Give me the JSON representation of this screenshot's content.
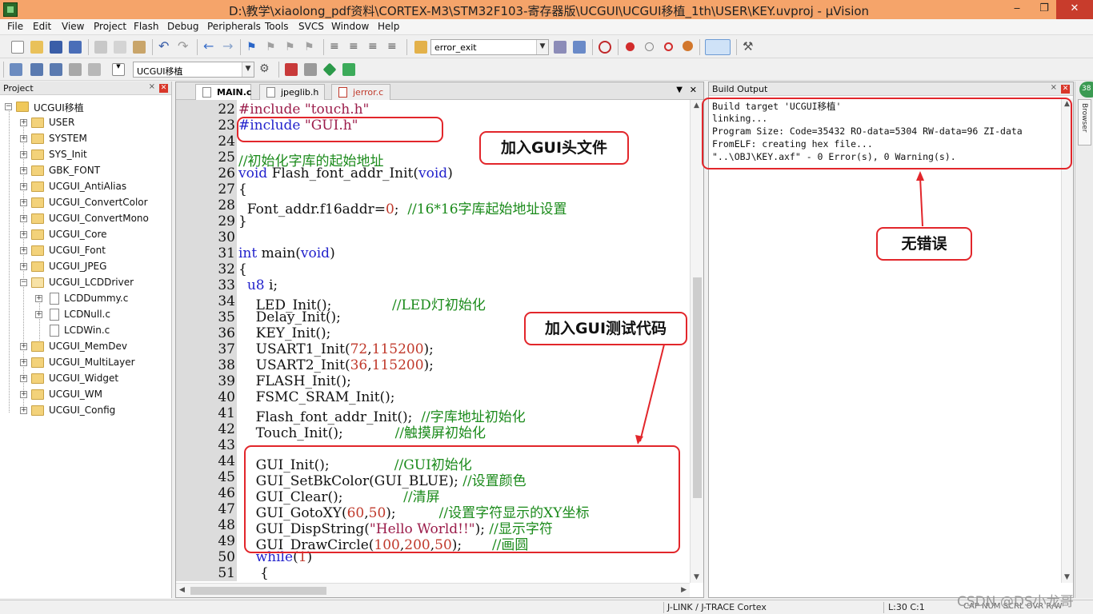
{
  "window": {
    "title": "D:\\教学\\xiaolong_pdf资料\\CORTEX-M3\\STM32F103-寄存器版\\UCGUI\\UCGUI移植_1th\\USER\\KEY.uvproj - µVision",
    "controls": [
      "minimize",
      "maximize",
      "close"
    ]
  },
  "menu": [
    "File",
    "Edit",
    "View",
    "Project",
    "Flash",
    "Debug",
    "Peripherals",
    "Tools",
    "SVCS",
    "Window",
    "Help"
  ],
  "toolbar": {
    "find_combo": "error_exit",
    "target_combo": "UCGUI移植"
  },
  "project_panel": {
    "title": "Project",
    "root": "UCGUI移植",
    "groups": [
      "USER",
      "SYSTEM",
      "SYS_Init",
      "GBK_FONT",
      "UCGUI_AntiAlias",
      "UCGUI_ConvertColor",
      "UCGUI_ConvertMono",
      "UCGUI_Core",
      "UCGUI_Font",
      "UCGUI_JPEG",
      "UCGUI_LCDDriver"
    ],
    "lcd_driver_files": [
      "LCDDummy.c",
      "LCDNull.c",
      "LCDWin.c"
    ],
    "groups_after": [
      "UCGUI_MemDev",
      "UCGUI_MultiLayer",
      "UCGUI_Widget",
      "UCGUI_WM",
      "UCGUI_Config"
    ]
  },
  "editor": {
    "tabs": [
      "MAIN.c",
      "jpeglib.h",
      "jerror.c"
    ],
    "active_tab": "MAIN.c",
    "lines": [
      {
        "n": "22",
        "parts": [
          {
            "t": "#include \"touch.h\"",
            "c": "str"
          }
        ]
      },
      {
        "n": "23",
        "parts": [
          {
            "t": "#include ",
            "c": "kw"
          },
          {
            "t": "\"GUI.h\"",
            "c": "str"
          }
        ]
      },
      {
        "n": "24",
        "parts": []
      },
      {
        "n": "25",
        "parts": [
          {
            "t": "//初始化字库的起始地址",
            "c": "cm"
          }
        ]
      },
      {
        "n": "26",
        "parts": [
          {
            "t": "void",
            "c": "kw"
          },
          {
            "t": " Flash_font_addr_Init(",
            "c": ""
          },
          {
            "t": "void",
            "c": "kw"
          },
          {
            "t": ")",
            "c": ""
          }
        ]
      },
      {
        "n": "27",
        "parts": [
          {
            "t": "{",
            "c": ""
          }
        ]
      },
      {
        "n": "28",
        "parts": [
          {
            "t": "  Font_addr.f16addr=",
            "c": ""
          },
          {
            "t": "0",
            "c": "num"
          },
          {
            "t": ";  ",
            "c": ""
          },
          {
            "t": "//16*16字库起始地址设置",
            "c": "cm"
          }
        ]
      },
      {
        "n": "29",
        "parts": [
          {
            "t": "}",
            "c": ""
          }
        ]
      },
      {
        "n": "30",
        "parts": []
      },
      {
        "n": "31",
        "parts": [
          {
            "t": "int",
            "c": "kw"
          },
          {
            "t": " main(",
            "c": ""
          },
          {
            "t": "void",
            "c": "kw"
          },
          {
            "t": ")",
            "c": ""
          }
        ]
      },
      {
        "n": "32",
        "parts": [
          {
            "t": "{",
            "c": ""
          }
        ]
      },
      {
        "n": "33",
        "parts": [
          {
            "t": "  ",
            "c": ""
          },
          {
            "t": "u8",
            "c": "kw"
          },
          {
            "t": " i;",
            "c": ""
          }
        ]
      },
      {
        "n": "34",
        "parts": [
          {
            "t": "    LED_Init();              ",
            "c": ""
          },
          {
            "t": "//LED灯初始化",
            "c": "cm"
          }
        ]
      },
      {
        "n": "35",
        "parts": [
          {
            "t": "    Delay_Init();",
            "c": ""
          }
        ]
      },
      {
        "n": "36",
        "parts": [
          {
            "t": "    KEY_Init();",
            "c": ""
          }
        ]
      },
      {
        "n": "37",
        "parts": [
          {
            "t": "    USART1_Init(",
            "c": ""
          },
          {
            "t": "72",
            "c": "num"
          },
          {
            "t": ",",
            "c": ""
          },
          {
            "t": "115200",
            "c": "num"
          },
          {
            "t": ");",
            "c": ""
          }
        ]
      },
      {
        "n": "38",
        "parts": [
          {
            "t": "    USART2_Init(",
            "c": ""
          },
          {
            "t": "36",
            "c": "num"
          },
          {
            "t": ",",
            "c": ""
          },
          {
            "t": "115200",
            "c": "num"
          },
          {
            "t": ");",
            "c": ""
          }
        ]
      },
      {
        "n": "39",
        "parts": [
          {
            "t": "    FLASH_Init();",
            "c": ""
          }
        ]
      },
      {
        "n": "40",
        "parts": [
          {
            "t": "    FSMC_SRAM_Init();",
            "c": ""
          }
        ]
      },
      {
        "n": "41",
        "parts": [
          {
            "t": "    Flash_font_addr_Init();  ",
            "c": ""
          },
          {
            "t": "//字库地址初始化",
            "c": "cm"
          }
        ]
      },
      {
        "n": "42",
        "parts": [
          {
            "t": "    Touch_Init();            ",
            "c": ""
          },
          {
            "t": "//触摸屏初始化",
            "c": "cm"
          }
        ]
      },
      {
        "n": "43",
        "parts": []
      },
      {
        "n": "44",
        "parts": [
          {
            "t": "    GUI_Init();               ",
            "c": ""
          },
          {
            "t": "//GUI初始化",
            "c": "cm"
          }
        ]
      },
      {
        "n": "45",
        "parts": [
          {
            "t": "    GUI_SetBkColor(GUI_BLUE); ",
            "c": ""
          },
          {
            "t": "//设置颜色",
            "c": "cm"
          }
        ]
      },
      {
        "n": "46",
        "parts": [
          {
            "t": "    GUI_Clear();              ",
            "c": ""
          },
          {
            "t": "//清屏",
            "c": "cm"
          }
        ]
      },
      {
        "n": "47",
        "parts": [
          {
            "t": "    GUI_GotoXY(",
            "c": ""
          },
          {
            "t": "60",
            "c": "num"
          },
          {
            "t": ",",
            "c": ""
          },
          {
            "t": "50",
            "c": "num"
          },
          {
            "t": ");          ",
            "c": ""
          },
          {
            "t": "//设置字符显示的XY坐标",
            "c": "cm"
          }
        ]
      },
      {
        "n": "48",
        "parts": [
          {
            "t": "    GUI_DispString(",
            "c": ""
          },
          {
            "t": "\"Hello World!!\"",
            "c": "str"
          },
          {
            "t": "); ",
            "c": ""
          },
          {
            "t": "//显示字符",
            "c": "cm"
          }
        ]
      },
      {
        "n": "49",
        "parts": [
          {
            "t": "    GUI_DrawCircle(",
            "c": ""
          },
          {
            "t": "100",
            "c": "num"
          },
          {
            "t": ",",
            "c": ""
          },
          {
            "t": "200",
            "c": "num"
          },
          {
            "t": ",",
            "c": ""
          },
          {
            "t": "50",
            "c": "num"
          },
          {
            "t": ");       ",
            "c": ""
          },
          {
            "t": "//画圆",
            "c": "cm"
          }
        ]
      },
      {
        "n": "50",
        "parts": [
          {
            "t": "    ",
            "c": ""
          },
          {
            "t": "while",
            "c": "kw"
          },
          {
            "t": "(",
            "c": ""
          },
          {
            "t": "1",
            "c": "num"
          },
          {
            "t": ")",
            "c": ""
          }
        ]
      },
      {
        "n": "51",
        "parts": [
          {
            "t": "     {",
            "c": ""
          }
        ]
      }
    ]
  },
  "build_output": {
    "title": "Build Output",
    "lines": [
      "Build target 'UCGUI移植'",
      "linking...",
      "Program Size: Code=35432 RO-data=5304 RW-data=96 ZI-data",
      "FromELF: creating hex file...",
      "\"..\\OBJ\\KEY.axf\" - 0 Error(s), 0 Warning(s)."
    ]
  },
  "side_strip": {
    "badge": "38",
    "tab_label": "Browser"
  },
  "status": {
    "debugger": "J-LINK / J-TRACE Cortex",
    "position": "L:30 C:1",
    "keys": "CAP  NUM  SCRL  OVR  R/W"
  },
  "watermark": "CSDN @DS小龙哥",
  "annotations": {
    "include_note": "加入GUI头文件",
    "test_code_note": "加入GUI测试代码",
    "no_error_note": "无错误"
  },
  "colors": {
    "titlebar": "#f5a46a",
    "annotation": "#e2262b",
    "keyword": "#2222cc",
    "comment": "#1a8a1a",
    "string": "#9b1c4a"
  }
}
